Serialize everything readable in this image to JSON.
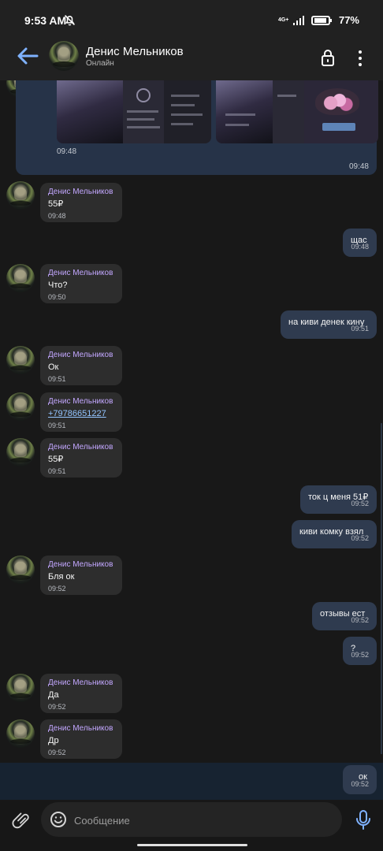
{
  "status_bar": {
    "time": "9:53 AM",
    "network": "4G+",
    "battery": "77%",
    "silent_icon": "mute-bell-icon",
    "wifi_icon": "wifi-icon",
    "signal_icon": "signal-icon",
    "battery_icon": "battery-icon"
  },
  "header": {
    "title": "Денис Мельников",
    "status": "Онлайн",
    "back_icon": "arrow-left-icon",
    "lock_icon": "lock-icon",
    "more_icon": "more-vertical-icon"
  },
  "messages": [
    {
      "type": "media",
      "inner_time": "09:48",
      "outer_time": "09:48"
    },
    {
      "type": "incoming",
      "sender": "Денис Мельников",
      "text": "55₽",
      "time": "09:48"
    },
    {
      "type": "outgoing",
      "text": "щас",
      "time": "09:48"
    },
    {
      "type": "incoming",
      "sender": "Денис Мельников",
      "text": "Что?",
      "time": "09:50"
    },
    {
      "type": "outgoing",
      "text": "на киви денек кину",
      "time": "09:51"
    },
    {
      "type": "incoming",
      "sender": "Денис Мельников",
      "text": "Ок",
      "time": "09:51"
    },
    {
      "type": "incoming",
      "sender": "Денис Мельников",
      "text": "+79786651227",
      "time": "09:51"
    },
    {
      "type": "incoming",
      "sender": "Денис Мельников",
      "text": "55₽",
      "time": "09:51"
    },
    {
      "type": "outgoing",
      "text": "ток ц меня 51₽",
      "time": "09:52"
    },
    {
      "type": "outgoing",
      "text": "киви комку взял",
      "time": "09:52"
    },
    {
      "type": "incoming",
      "sender": "Денис Мельников",
      "text": "Бля ок",
      "time": "09:52"
    },
    {
      "type": "outgoing",
      "text": "отзывы ест",
      "time": "09:52"
    },
    {
      "type": "outgoing",
      "text": "?",
      "time": "09:52"
    },
    {
      "type": "incoming",
      "sender": "Денис Мельников",
      "text": "Да",
      "time": "09:52"
    },
    {
      "type": "incoming",
      "sender": "Денис Мельников",
      "text": "Др",
      "time": "09:52"
    },
    {
      "type": "outgoing",
      "text": "ок",
      "time": "09:52"
    }
  ],
  "input": {
    "placeholder": "Сообщение",
    "attach_icon": "paperclip-icon",
    "emoji_icon": "smile-icon",
    "mic_icon": "microphone-icon"
  },
  "colors": {
    "background": "#181818",
    "topbar": "#212121",
    "incoming_bubble": "#2d2d2d",
    "outgoing_bubble": "#2f3b4f",
    "sender_name": "#c3a7ff",
    "accent": "#7fb2ff",
    "link": "#93c4ff"
  }
}
